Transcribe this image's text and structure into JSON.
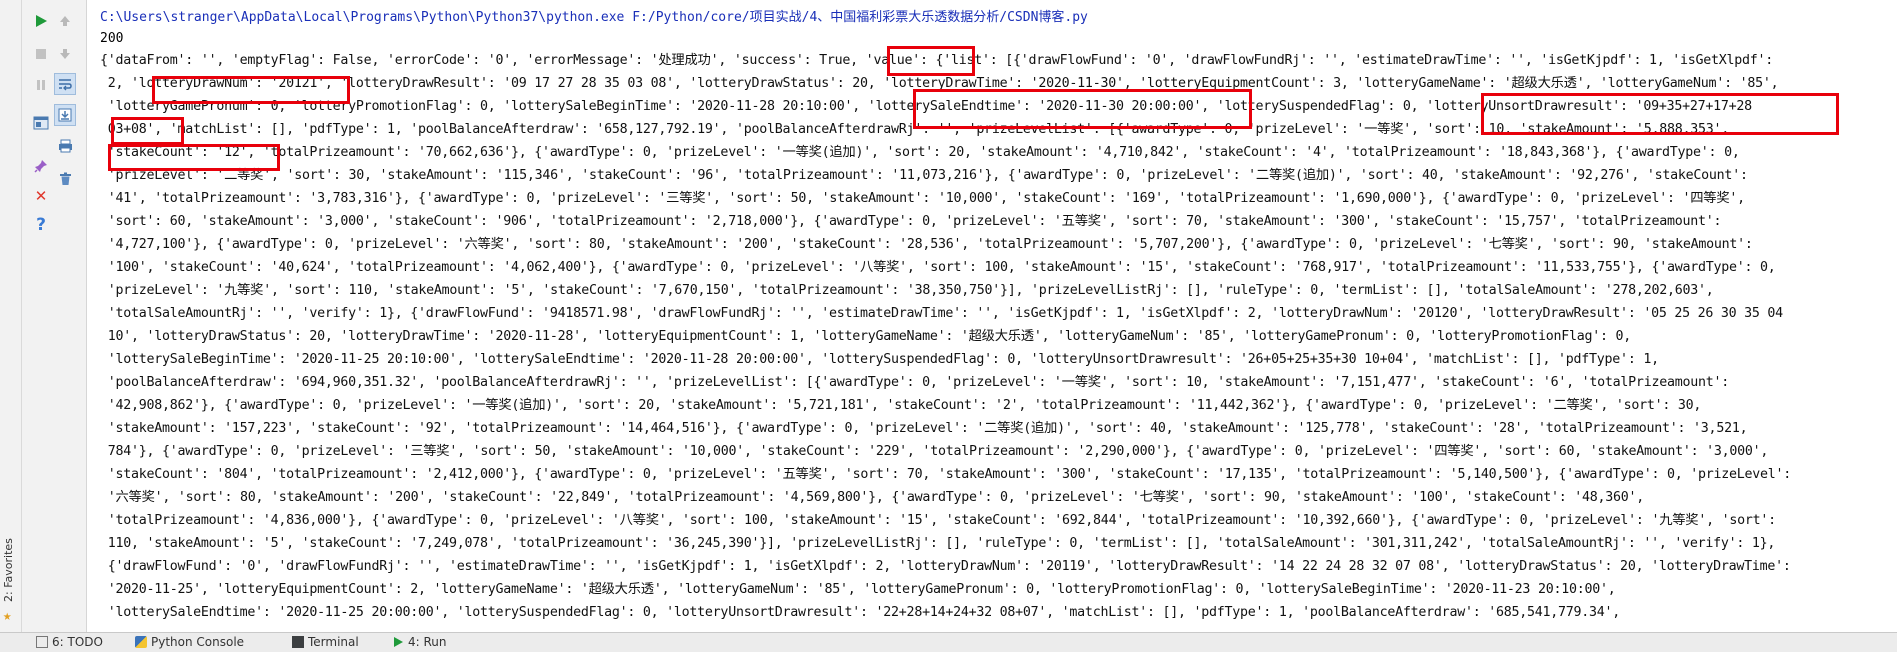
{
  "favorites": {
    "label": "2: Favorites"
  },
  "toolbar": {
    "rerun_icon": "play-icon",
    "up_icon": "arrow-up-icon",
    "stop_icon": "stop-icon",
    "down_icon": "arrow-down-icon",
    "pause_icon": "pause-icon",
    "softwrap_icon": "soft-wrap-icon",
    "layout_icon": "layout-icon",
    "scroll_end_icon": "scroll-to-end-icon",
    "print_icon": "print-icon",
    "trash_icon": "trash-icon",
    "pin_icon": "pin-icon",
    "close_icon": "close-icon",
    "help_icon": "help-icon"
  },
  "console": {
    "command": "C:\\Users\\stranger\\AppData\\Local\\Programs\\Python\\Python37\\python.exe F:/Python/core/项目实战/4、中国福利彩票大乐透数据分析/CSDN博客.py",
    "status_code": "200",
    "lines": [
      "{'dataFrom': '', 'emptyFlag': False, 'errorCode': '0', 'errorMessage': '处理成功', 'success': True, 'value': {'list': [{'drawFlowFund': '0', 'drawFlowFundRj': '', 'estimateDrawTime': '', 'isGetKjpdf': 1, 'isGetXlpdf':",
      " 2, 'lotteryDrawNum': '20121', 'lotteryDrawResult': '09 17 27 28 35 03 08', 'lotteryDrawStatus': 20, 'lotteryDrawTime': '2020-11-30', 'lotteryEquipmentCount': 3, 'lotteryGameName': '超级大乐透', 'lotteryGameNum': '85',",
      " 'lotteryGamePronum': 0, 'lotteryPromotionFlag': 0, 'lotterySaleBeginTime': '2020-11-28 20:10:00', 'lotterySaleEndtime': '2020-11-30 20:00:00', 'lotterySuspendedFlag': 0, 'lotteryUnsortDrawresult': '09+35+27+17+28",
      " 03+08', 'matchList': [], 'pdfType': 1, 'poolBalanceAfterdraw': '658,127,792.19', 'poolBalanceAfterdrawRj': '', 'prizeLevelList': [{'awardType': 0, 'prizeLevel': '一等奖', 'sort': 10, 'stakeAmount': '5,888,353',",
      " 'stakeCount': '12', 'totalPrizeamount': '70,662,636'}, {'awardType': 0, 'prizeLevel': '一等奖(追加)', 'sort': 20, 'stakeAmount': '4,710,842', 'stakeCount': '4', 'totalPrizeamount': '18,843,368'}, {'awardType': 0,",
      " 'prizeLevel': '二等奖', 'sort': 30, 'stakeAmount': '115,346', 'stakeCount': '96', 'totalPrizeamount': '11,073,216'}, {'awardType': 0, 'prizeLevel': '二等奖(追加)', 'sort': 40, 'stakeAmount': '92,276', 'stakeCount':",
      " '41', 'totalPrizeamount': '3,783,316'}, {'awardType': 0, 'prizeLevel': '三等奖', 'sort': 50, 'stakeAmount': '10,000', 'stakeCount': '169', 'totalPrizeamount': '1,690,000'}, {'awardType': 0, 'prizeLevel': '四等奖',",
      " 'sort': 60, 'stakeAmount': '3,000', 'stakeCount': '906', 'totalPrizeamount': '2,718,000'}, {'awardType': 0, 'prizeLevel': '五等奖', 'sort': 70, 'stakeAmount': '300', 'stakeCount': '15,757', 'totalPrizeamount':",
      " '4,727,100'}, {'awardType': 0, 'prizeLevel': '六等奖', 'sort': 80, 'stakeAmount': '200', 'stakeCount': '28,536', 'totalPrizeamount': '5,707,200'}, {'awardType': 0, 'prizeLevel': '七等奖', 'sort': 90, 'stakeAmount':",
      " '100', 'stakeCount': '40,624', 'totalPrizeamount': '4,062,400'}, {'awardType': 0, 'prizeLevel': '八等奖', 'sort': 100, 'stakeAmount': '15', 'stakeCount': '768,917', 'totalPrizeamount': '11,533,755'}, {'awardType': 0,",
      " 'prizeLevel': '九等奖', 'sort': 110, 'stakeAmount': '5', 'stakeCount': '7,670,150', 'totalPrizeamount': '38,350,750'}], 'prizeLevelListRj': [], 'ruleType': 0, 'termList': [], 'totalSaleAmount': '278,202,603',",
      " 'totalSaleAmountRj': '', 'verify': 1}, {'drawFlowFund': '9418571.98', 'drawFlowFundRj': '', 'estimateDrawTime': '', 'isGetKjpdf': 1, 'isGetXlpdf': 2, 'lotteryDrawNum': '20120', 'lotteryDrawResult': '05 25 26 30 35 04",
      " 10', 'lotteryDrawStatus': 20, 'lotteryDrawTime': '2020-11-28', 'lotteryEquipmentCount': 1, 'lotteryGameName': '超级大乐透', 'lotteryGameNum': '85', 'lotteryGamePronum': 0, 'lotteryPromotionFlag': 0,",
      " 'lotterySaleBeginTime': '2020-11-25 20:10:00', 'lotterySaleEndtime': '2020-11-28 20:00:00', 'lotterySuspendedFlag': 0, 'lotteryUnsortDrawresult': '26+05+25+35+30 10+04', 'matchList': [], 'pdfType': 1,",
      " 'poolBalanceAfterdraw': '694,960,351.32', 'poolBalanceAfterdrawRj': '', 'prizeLevelList': [{'awardType': 0, 'prizeLevel': '一等奖', 'sort': 10, 'stakeAmount': '7,151,477', 'stakeCount': '6', 'totalPrizeamount':",
      " '42,908,862'}, {'awardType': 0, 'prizeLevel': '一等奖(追加)', 'sort': 20, 'stakeAmount': '5,721,181', 'stakeCount': '2', 'totalPrizeamount': '11,442,362'}, {'awardType': 0, 'prizeLevel': '二等奖', 'sort': 30,",
      " 'stakeAmount': '157,223', 'stakeCount': '92', 'totalPrizeamount': '14,464,516'}, {'awardType': 0, 'prizeLevel': '二等奖(追加)', 'sort': 40, 'stakeAmount': '125,778', 'stakeCount': '28', 'totalPrizeamount': '3,521,",
      " 784'}, {'awardType': 0, 'prizeLevel': '三等奖', 'sort': 50, 'stakeAmount': '10,000', 'stakeCount': '229', 'totalPrizeamount': '2,290,000'}, {'awardType': 0, 'prizeLevel': '四等奖', 'sort': 60, 'stakeAmount': '3,000',",
      " 'stakeCount': '804', 'totalPrizeamount': '2,412,000'}, {'awardType': 0, 'prizeLevel': '五等奖', 'sort': 70, 'stakeAmount': '300', 'stakeCount': '17,135', 'totalPrizeamount': '5,140,500'}, {'awardType': 0, 'prizeLevel':",
      " '六等奖', 'sort': 80, 'stakeAmount': '200', 'stakeCount': '22,849', 'totalPrizeamount': '4,569,800'}, {'awardType': 0, 'prizeLevel': '七等奖', 'sort': 90, 'stakeAmount': '100', 'stakeCount': '48,360',",
      " 'totalPrizeamount': '4,836,000'}, {'awardType': 0, 'prizeLevel': '八等奖', 'sort': 100, 'stakeAmount': '15', 'stakeCount': '692,844', 'totalPrizeamount': '10,392,660'}, {'awardType': 0, 'prizeLevel': '九等奖', 'sort':",
      " 110, 'stakeAmount': '5', 'stakeCount': '7,249,078', 'totalPrizeamount': '36,245,390'}], 'prizeLevelListRj': [], 'ruleType': 0, 'termList': [], 'totalSaleAmount': '301,311,242', 'totalSaleAmountRj': '', 'verify': 1},",
      " {'drawFlowFund': '0', 'drawFlowFundRj': '', 'estimateDrawTime': '', 'isGetKjpdf': 1, 'isGetXlpdf': 2, 'lotteryDrawNum': '20119', 'lotteryDrawResult': '14 22 24 28 32 07 08', 'lotteryDrawStatus': 20, 'lotteryDrawTime':",
      " '2020-11-25', 'lotteryEquipmentCount': 2, 'lotteryGameName': '超级大乐透', 'lotteryGameNum': '85', 'lotteryGamePronum': 0, 'lotteryPromotionFlag': 0, 'lotterySaleBeginTime': '2020-11-23 20:10:00',",
      " 'lotterySaleEndtime': '2020-11-25 20:00:00', 'lotterySuspendedFlag': 0, 'lotteryUnsortDrawresult': '22+28+14+24+32 08+07', 'matchList': [], 'pdfType': 1, 'poolBalanceAfterdraw': '685,541,779.34',"
    ]
  },
  "bottom_bar": {
    "todo": "6: TODO",
    "python_console": "Python Console",
    "terminal": "Terminal",
    "run": "4: Run"
  },
  "colors": {
    "command_text": "#1a2fb8",
    "highlight_border": "#e8000b",
    "run_green": "#1f9a3a"
  }
}
